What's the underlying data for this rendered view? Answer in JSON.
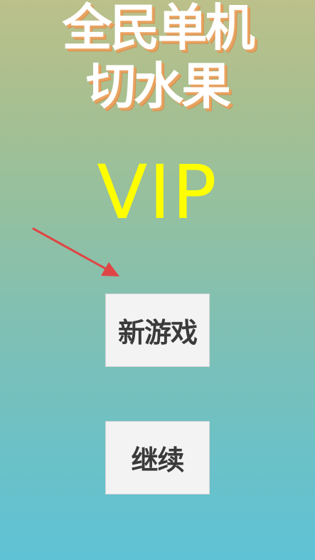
{
  "title": {
    "line1": "全民单机",
    "line2": "切水果"
  },
  "badge": {
    "text": "VIP"
  },
  "menu": {
    "new_game_label": "新游戏",
    "continue_label": "继续"
  },
  "colors": {
    "title_text": "#ffffff",
    "title_shadow": "#e9a361",
    "vip_text": "#ffff00",
    "arrow": "#e04545",
    "button_bg": "#f3f3f3",
    "button_text": "#3a3a3a"
  },
  "icons": {
    "pointer_arrow": "arrow-right-down-icon"
  }
}
